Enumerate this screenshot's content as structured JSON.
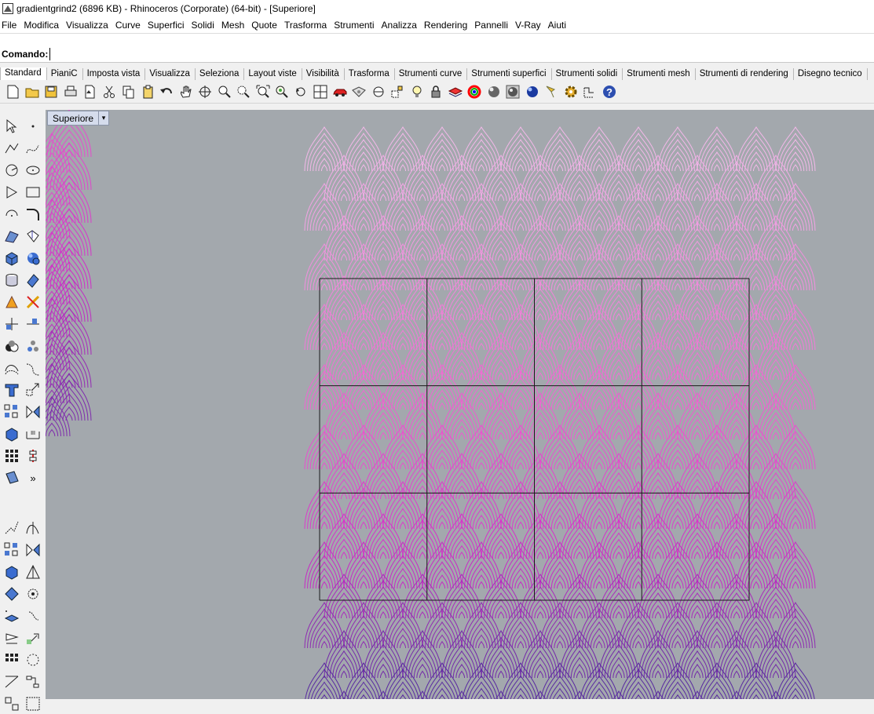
{
  "window": {
    "title": "gradientgrind2 (6896 KB) - Rhinoceros (Corporate) (64-bit) - [Superiore]"
  },
  "menu": [
    "File",
    "Modifica",
    "Visualizza",
    "Curve",
    "Superfici",
    "Solidi",
    "Mesh",
    "Quote",
    "Trasforma",
    "Strumenti",
    "Analizza",
    "Rendering",
    "Pannelli",
    "V-Ray",
    "Aiuti"
  ],
  "command": {
    "label": "Comando:",
    "value": ""
  },
  "tabs": [
    "Standard",
    "PianiC",
    "Imposta vista",
    "Visualizza",
    "Seleziona",
    "Layout viste",
    "Visibilità",
    "Trasforma",
    "Strumenti curve",
    "Strumenti superfici",
    "Strumenti solidi",
    "Strumenti mesh",
    "Strumenti di rendering",
    "Disegno tecnico"
  ],
  "active_tab": "Standard",
  "toolbar_icons": [
    "new-file-icon",
    "open-folder-icon",
    "save-icon",
    "print-icon",
    "import-icon",
    "cut-icon",
    "copy-icon",
    "paste-icon",
    "undo-icon",
    "pan-hand-icon",
    "rotate-view-icon",
    "zoom-window-icon",
    "zoom-dynamic-icon",
    "zoom-extents-icon",
    "zoom-selected-icon",
    "undo-view-icon",
    "four-viewports-icon",
    "car-icon",
    "camera-icon",
    "cplane-icon",
    "point-snap-icon",
    "light-bulb-icon",
    "lock-icon",
    "layer-icon",
    "color-wheel-icon",
    "material-sphere-icon",
    "render-preview-icon",
    "render-sphere-icon",
    "spotlight-icon",
    "gear-icon",
    "grid-snap-icon",
    "help-icon"
  ],
  "left_tools": [
    "select-arrow-icon",
    "point-icon",
    "polyline-icon",
    "curve-icon",
    "circle-icon",
    "ellipse-icon",
    "polygon-icon",
    "rectangle-icon",
    "arc-icon",
    "fillet-icon",
    "surface-icon",
    "extrude-icon",
    "box-icon",
    "sphere-icon",
    "cylinder-icon",
    "surface-patch-icon",
    "explode-icon",
    "split-icon",
    "trim-icon",
    "extend-icon",
    "boolean-union-icon",
    "boolean-split-icon",
    "offset-icon",
    "blend-icon",
    "text-icon",
    "scale-icon",
    "array-icon",
    "mirror-icon",
    "solid-edit-icon",
    "dimension-icon",
    "grid-array-icon",
    "align-icon",
    "project-icon",
    "more-icon"
  ],
  "viewport": {
    "name": "Superiore",
    "dropdown_glyph": "▾",
    "more_glyph": "»"
  },
  "colors": {
    "viewport_bg": "#a3a8ad",
    "curves_top": "#f3c8ee",
    "curves_mid": "#f05fd0",
    "curves_magenta": "#d02cc8",
    "curves_bottom": "#5a2aa0",
    "grid_line": "#1a1a1a"
  }
}
